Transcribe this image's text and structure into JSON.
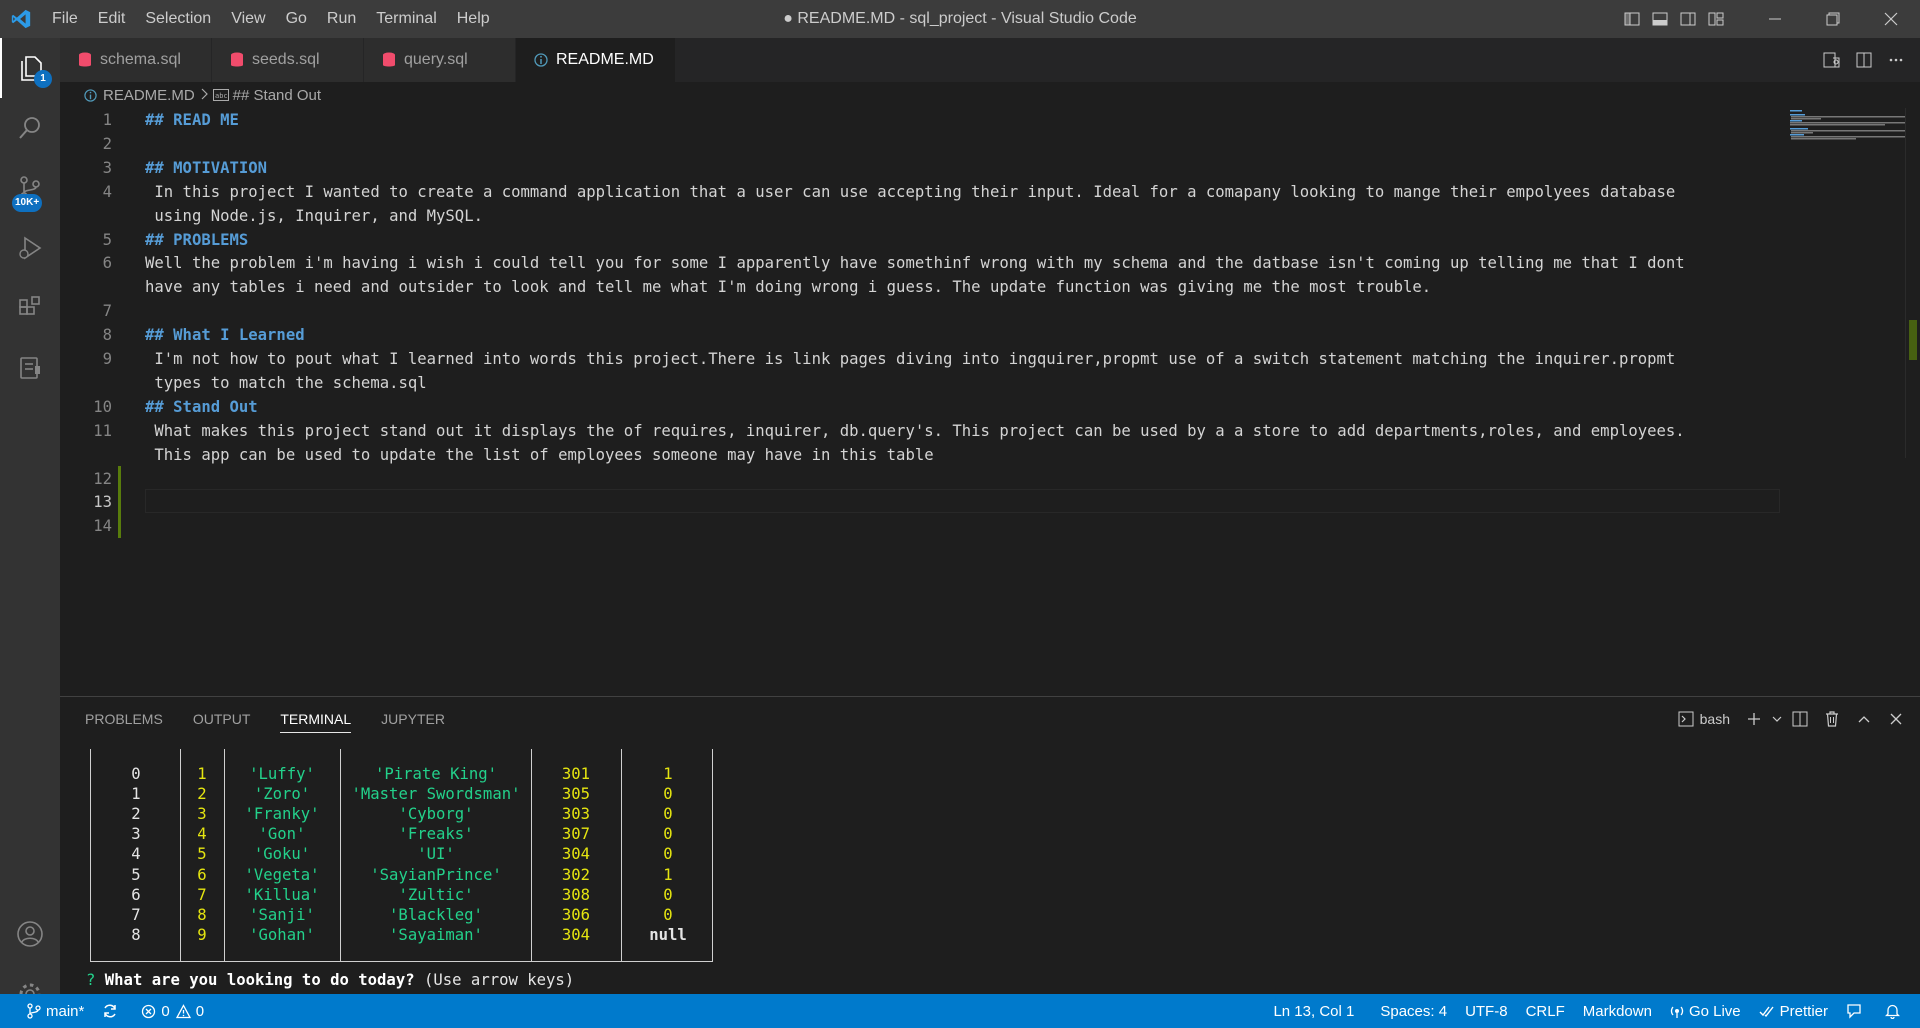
{
  "window": {
    "title": "● README.MD - sql_project - Visual Studio Code"
  },
  "menu": [
    "File",
    "Edit",
    "Selection",
    "View",
    "Go",
    "Run",
    "Terminal",
    "Help"
  ],
  "activity": {
    "explorer_badge": "1",
    "scm_badge": "10K+"
  },
  "tabs": [
    {
      "label": "schema.sql",
      "icon": "database-icon"
    },
    {
      "label": "seeds.sql",
      "icon": "database-icon"
    },
    {
      "label": "query.sql",
      "icon": "database-icon"
    },
    {
      "label": "README.MD",
      "icon": "info-icon",
      "active": true,
      "dirty": true
    }
  ],
  "breadcrumb": {
    "file": "README.MD",
    "section": "## Stand Out"
  },
  "editor": {
    "line_numbers": [
      "1",
      "2",
      "3",
      "4",
      "5",
      "6",
      "7",
      "8",
      "9",
      "10",
      "11",
      "12",
      "13",
      "14"
    ],
    "lines": [
      {
        "n": "1",
        "text": "## READ ME",
        "heading": true
      },
      {
        "n": "2",
        "text": ""
      },
      {
        "n": "3",
        "text": "## MOTIVATION",
        "heading": true
      },
      {
        "n": "4",
        "text": " In this project I wanted to create a command application that a user can use accepting their input. Ideal for a comapany looking to mange their empolyees database"
      },
      {
        "n": "",
        "text": " using Node.js, Inquirer, and MySQL."
      },
      {
        "n": "5",
        "text": "## PROBLEMS",
        "heading": true
      },
      {
        "n": "6",
        "text": "Well the problem i'm having i wish i could tell you for some I apparently have somethinf wrong with my schema and the datbase isn't coming up telling me that I dont"
      },
      {
        "n": "",
        "text": "have any tables i need and outsider to look and tell me what I'm doing wrong i guess. The update function was giving me the most trouble."
      },
      {
        "n": "7",
        "text": ""
      },
      {
        "n": "8",
        "text": "## What I Learned",
        "heading": true
      },
      {
        "n": "9",
        "text": " I'm not how to pout what I learned into words this project.There is link pages diving into ingquirer,propmt use of a switch statement matching the inquirer.propmt"
      },
      {
        "n": "",
        "text": " types to match the schema.sql"
      },
      {
        "n": "10",
        "text": "## Stand Out",
        "heading": true
      },
      {
        "n": "11",
        "text": " What makes this project stand out it displays the of requires, inquirer, db.query's. This project can be used by a a store to add departments,roles, and employees."
      },
      {
        "n": "",
        "text": " This app can be used to update the list of employees someone may have in this table"
      },
      {
        "n": "12",
        "text": ""
      },
      {
        "n": "13",
        "text": ""
      },
      {
        "n": "14",
        "text": ""
      }
    ]
  },
  "panel": {
    "tabs": [
      "PROBLEMS",
      "OUTPUT",
      "TERMINAL",
      "JUPYTER"
    ],
    "active_tab": "TERMINAL",
    "shell": "bash"
  },
  "terminal": {
    "rows": [
      [
        "0",
        "1",
        "'Luffy'",
        "'Pirate King'",
        "301",
        "1"
      ],
      [
        "1",
        "2",
        "'Zoro'",
        "'Master Swordsman'",
        "305",
        "0"
      ],
      [
        "2",
        "3",
        "'Franky'",
        "'Cyborg'",
        "303",
        "0"
      ],
      [
        "3",
        "4",
        "'Gon'",
        "'Freaks'",
        "307",
        "0"
      ],
      [
        "4",
        "5",
        "'Goku'",
        "'UI'",
        "304",
        "0"
      ],
      [
        "5",
        "6",
        "'Vegeta'",
        "'SayianPrince'",
        "302",
        "1"
      ],
      [
        "6",
        "7",
        "'Killua'",
        "'Zultic'",
        "308",
        "0"
      ],
      [
        "7",
        "8",
        "'Sanji'",
        "'Blackleg'",
        "306",
        "0"
      ],
      [
        "8",
        "9",
        "'Gohan'",
        "'Sayaiman'",
        "304",
        "null"
      ]
    ],
    "prompt_mark": "?",
    "prompt_question": "What are you looking to do today?",
    "prompt_hint": "(Use arrow keys)"
  },
  "status": {
    "branch": "main*",
    "errors": "0",
    "warnings": "0",
    "position": "Ln 13, Col 1",
    "spaces": "Spaces: 4",
    "encoding": "UTF-8",
    "eol": "CRLF",
    "language": "Markdown",
    "golive": "Go Live",
    "prettier": "Prettier"
  },
  "colors": {
    "accent": "#007acc",
    "heading": "#569cd6",
    "term_yellow": "#e5e510",
    "term_green": "#23d18b"
  }
}
